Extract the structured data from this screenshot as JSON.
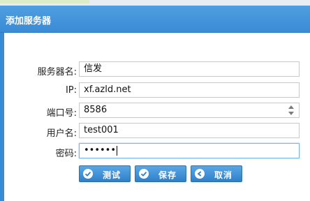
{
  "dialog": {
    "title": "添加服务器"
  },
  "form": {
    "server_name": {
      "label": "服务器名:",
      "value": "信发"
    },
    "ip": {
      "label": "IP:",
      "value": "xf.azld.net"
    },
    "port": {
      "label": "端口号:",
      "value": "8586"
    },
    "username": {
      "label": "用户名:",
      "value": "test001"
    },
    "password": {
      "label": "密码:",
      "value": "••••••"
    }
  },
  "buttons": {
    "test": "测试",
    "save": "保存",
    "cancel": "取消"
  },
  "colors": {
    "titlebar": "#3a8bd6",
    "button": "#3d8fd6"
  }
}
